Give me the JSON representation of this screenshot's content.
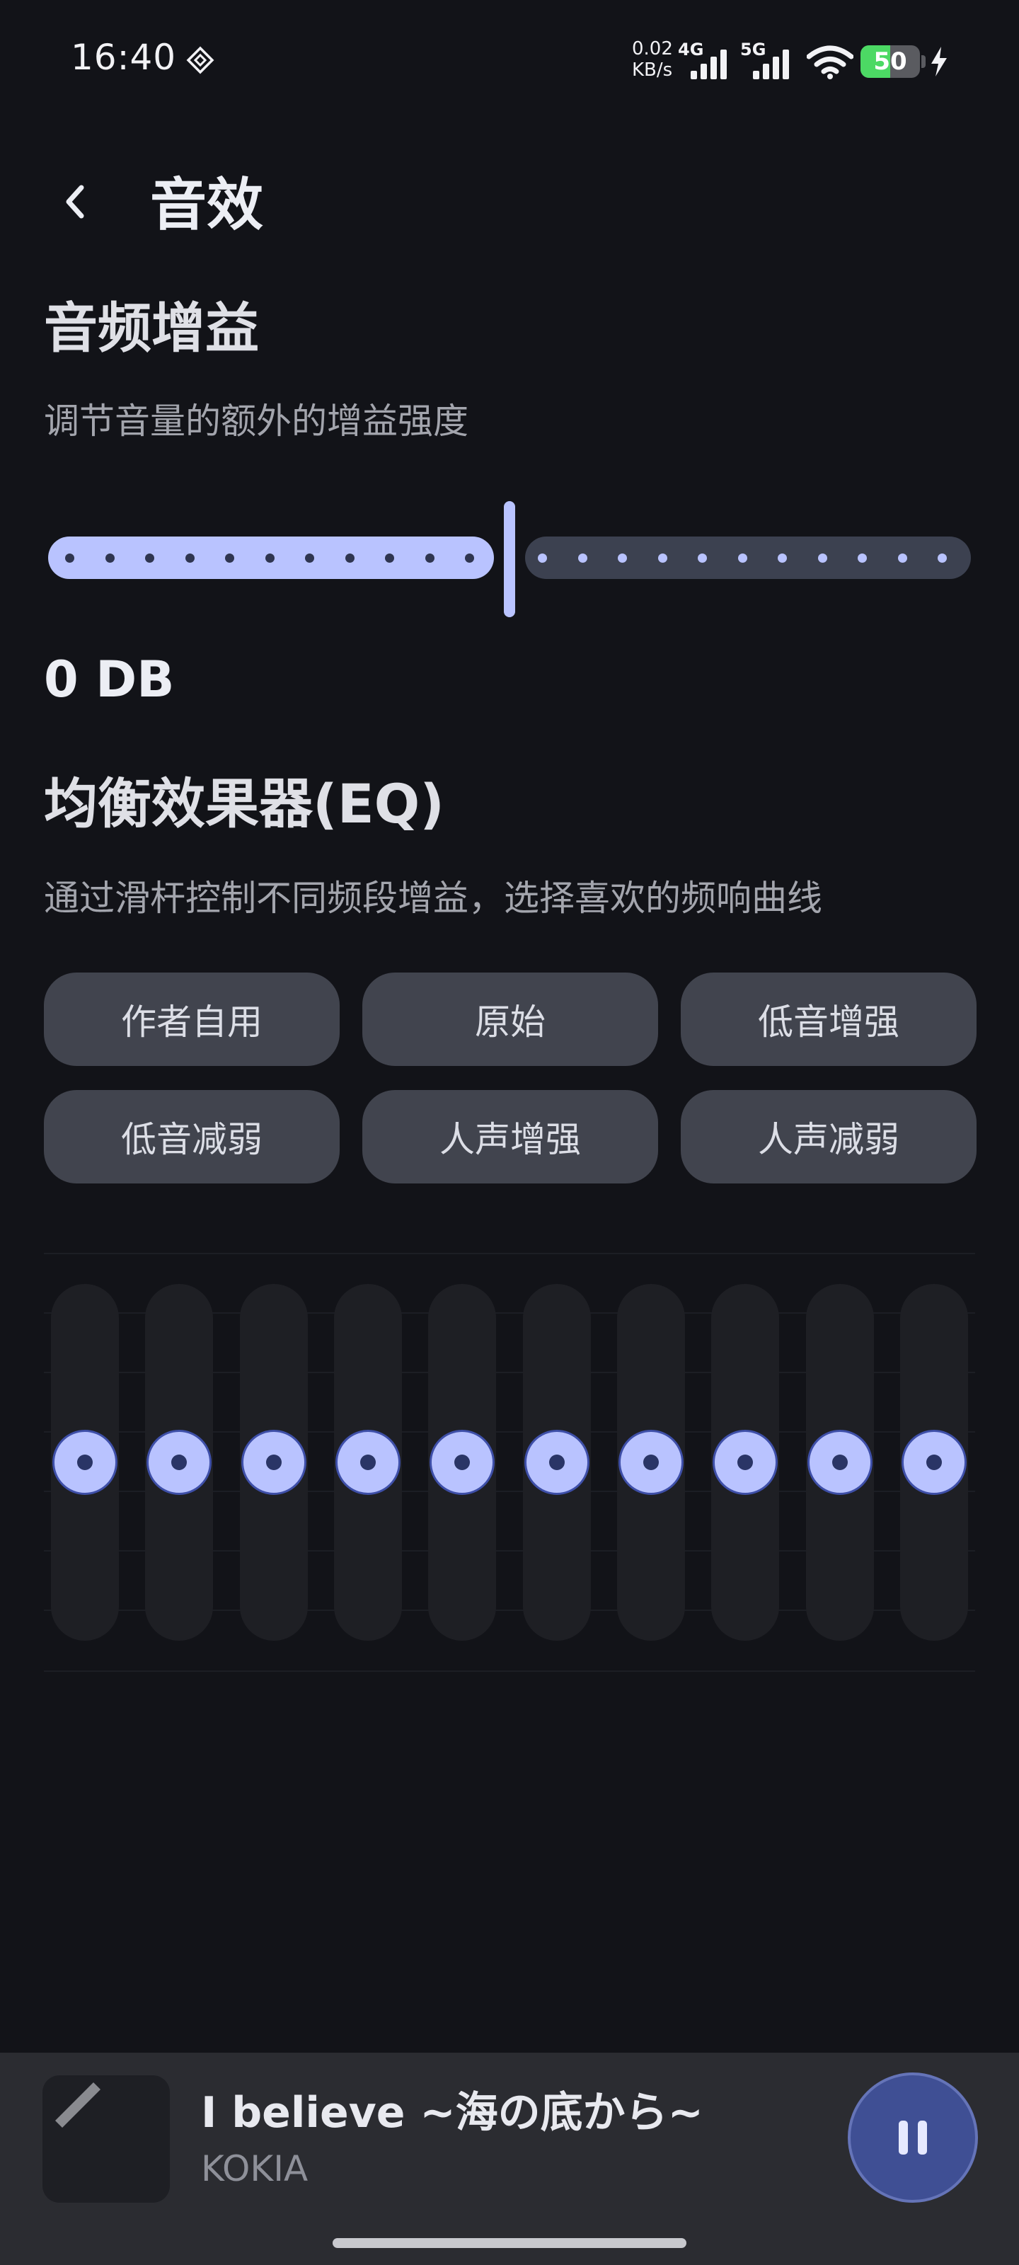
{
  "status_bar": {
    "time": "16:40",
    "net_speed_value": "0.02",
    "net_speed_unit": "KB/s",
    "sim1_type": "4G",
    "sim2_type": "5G",
    "battery_level": 50,
    "battery_text": "50"
  },
  "header": {
    "title": "音效"
  },
  "gain": {
    "title": "音频增益",
    "description": "调节音量的额外的增益强度",
    "value_label": "0 DB",
    "slider_fraction": 0.5
  },
  "eq": {
    "title": "均衡效果器(EQ)",
    "description": "通过滑杆控制不同频段增益，选择喜欢的频响曲线",
    "presets": [
      "作者自用",
      "原始",
      "低音增强",
      "低音减弱",
      "人声增强",
      "人声减弱"
    ],
    "band_levels": [
      0.5,
      0.5,
      0.5,
      0.5,
      0.5,
      0.5,
      0.5,
      0.5,
      0.5,
      0.5
    ]
  },
  "player": {
    "title": "I believe ~海の底から~",
    "artist": "KOKIA"
  },
  "colors": {
    "accent": "#b9c3ff",
    "background": "#121318",
    "battery_green": "#4cd964"
  }
}
